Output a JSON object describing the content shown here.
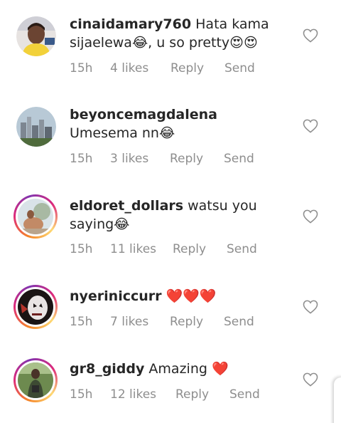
{
  "comments": [
    {
      "username": "cinaidamary760",
      "text": " Hata kama sijaelewa😂, u so pretty😍😍",
      "time": "15h",
      "likes": "4 likes",
      "reply": "Reply",
      "send": "Send",
      "avatar_icon": "profile-photo",
      "has_story_ring": false
    },
    {
      "username": "beyoncemagdalena",
      "text": " Umesema nn😂",
      "time": "15h",
      "likes": "3 likes",
      "reply": "Reply",
      "send": "Send",
      "avatar_icon": "city-skyline-photo",
      "has_story_ring": false
    },
    {
      "username": "eldoret_dollars",
      "text": " watsu you saying😂",
      "time": "15h",
      "likes": "11 likes",
      "reply": "Reply",
      "send": "Send",
      "avatar_icon": "profile-photo",
      "has_story_ring": true
    },
    {
      "username": "nyeriniccurr",
      "text": " ❤️❤️❤️",
      "time": "15h",
      "likes": "7 likes",
      "reply": "Reply",
      "send": "Send",
      "avatar_icon": "masked-face-photo",
      "has_story_ring": true
    },
    {
      "username": "gr8_giddy",
      "text": " Amazing ❤️",
      "time": "15h",
      "likes": "12 likes",
      "reply": "Reply",
      "send": "Send",
      "avatar_icon": "outdoor-portrait-photo",
      "has_story_ring": true
    }
  ],
  "colors": {
    "text": "#262626",
    "meta": "#8e8e8e",
    "story_ring_start": "#f58529",
    "story_ring_mid": "#dd2a7b",
    "story_ring_end": "#8134af"
  },
  "icons": {
    "like": "heart-outline-icon"
  }
}
